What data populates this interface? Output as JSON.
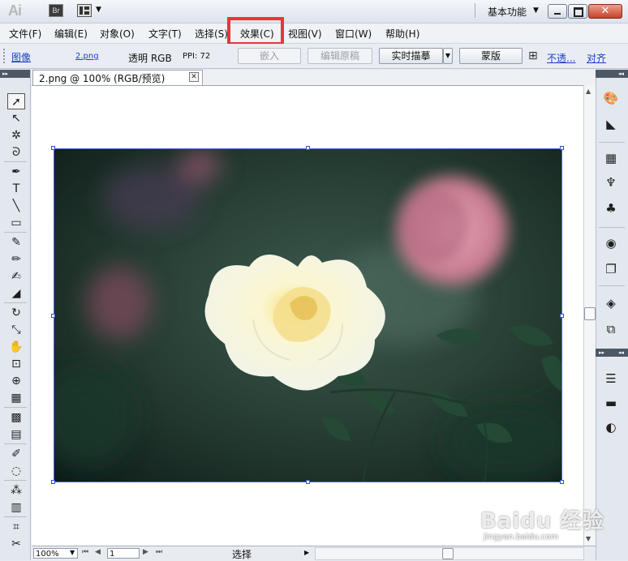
{
  "app": {
    "logo": "Ai",
    "bridge_button": "Br",
    "workspace": "基本功能"
  },
  "menu": [
    {
      "label": "文件(F)"
    },
    {
      "label": "编辑(E)"
    },
    {
      "label": "对象(O)"
    },
    {
      "label": "文字(T)"
    },
    {
      "label": "选择(S)"
    },
    {
      "label": "效果(C)"
    },
    {
      "label": "视图(V)"
    },
    {
      "label": "窗口(W)"
    },
    {
      "label": "帮助(H)"
    }
  ],
  "highlight_color": "#e8353b",
  "control_bar": {
    "object_type": "图像",
    "file_link": "2.png",
    "color_mode": "透明 RGB",
    "ppi": "PPI: 72",
    "embed_button": "嵌入",
    "edit_original_button": "编辑原稿",
    "live_trace_button": "实时描摹",
    "mask_button": "蒙版",
    "opacity_link": "不透...",
    "align_link": "对齐"
  },
  "document": {
    "tab_title": "2.png @ 100% (RGB/预览)",
    "tab_close": "✕"
  },
  "status_bar": {
    "zoom": "100%",
    "page": "1",
    "tool_status": "选择"
  },
  "tools": [
    {
      "name": "selection-tool-icon",
      "glyph": "➚"
    },
    {
      "name": "direct-selection-tool-icon",
      "glyph": "↖"
    },
    {
      "name": "magic-wand-tool-icon",
      "glyph": "✲"
    },
    {
      "name": "lasso-tool-icon",
      "glyph": "ᘐ"
    },
    {
      "name": "pen-tool-icon",
      "glyph": "✒"
    },
    {
      "name": "type-tool-icon",
      "glyph": "T"
    },
    {
      "name": "line-tool-icon",
      "glyph": "╲"
    },
    {
      "name": "rectangle-tool-icon",
      "glyph": "▭"
    },
    {
      "name": "paintbrush-tool-icon",
      "glyph": "✎"
    },
    {
      "name": "pencil-tool-icon",
      "glyph": "✏"
    },
    {
      "name": "blob-brush-tool-icon",
      "glyph": "✍"
    },
    {
      "name": "eraser-tool-icon",
      "glyph": "◢"
    },
    {
      "name": "rotate-tool-icon",
      "glyph": "↻"
    },
    {
      "name": "scale-tool-icon",
      "glyph": "⤡"
    },
    {
      "name": "warp-tool-icon",
      "glyph": "✋"
    },
    {
      "name": "free-transform-tool-icon",
      "glyph": "⊡"
    },
    {
      "name": "shape-builder-tool-icon",
      "glyph": "⊕"
    },
    {
      "name": "perspective-grid-tool-icon",
      "glyph": "▦"
    },
    {
      "name": "mesh-tool-icon",
      "glyph": "▩"
    },
    {
      "name": "gradient-tool-icon",
      "glyph": "▤"
    },
    {
      "name": "eyedropper-tool-icon",
      "glyph": "✐"
    },
    {
      "name": "blend-tool-icon",
      "glyph": "◌"
    },
    {
      "name": "symbol-sprayer-tool-icon",
      "glyph": "⁂"
    },
    {
      "name": "column-graph-tool-icon",
      "glyph": "▥"
    },
    {
      "name": "artboard-tool-icon",
      "glyph": "⌗"
    },
    {
      "name": "slice-tool-icon",
      "glyph": "✂"
    }
  ],
  "right_panel": [
    {
      "name": "color-panel-icon",
      "glyph": "🎨"
    },
    {
      "name": "color-guide-panel-icon",
      "glyph": "◣"
    },
    {
      "name": "swatches-panel-icon",
      "glyph": "▦"
    },
    {
      "name": "brushes-panel-icon",
      "glyph": "♆"
    },
    {
      "name": "symbols-panel-icon",
      "glyph": "♣"
    },
    {
      "name": "graphic-styles-panel-icon",
      "glyph": "◉"
    },
    {
      "name": "appearance-panel-icon",
      "glyph": "❐"
    },
    {
      "name": "layers-panel-icon",
      "glyph": "◈"
    },
    {
      "name": "artboards-panel-icon",
      "glyph": "⧉"
    },
    {
      "name": "stroke-panel-icon",
      "glyph": "☰"
    },
    {
      "name": "gradient-panel-icon",
      "glyph": "▬"
    },
    {
      "name": "transparency-panel-icon",
      "glyph": "◐"
    }
  ],
  "watermark": {
    "main": "Baidu 经验",
    "sub": "jingyan.baidu.com"
  }
}
